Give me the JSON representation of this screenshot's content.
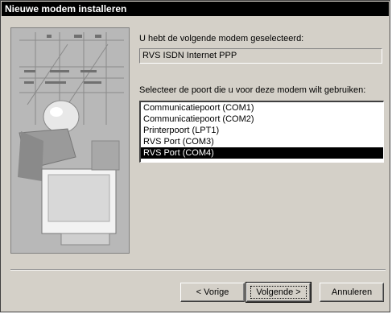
{
  "window": {
    "title": "Nieuwe modem installeren"
  },
  "content": {
    "selected_label": "U hebt de volgende modem geselecteerd:",
    "selected_modem": "RVS ISDN Internet PPP",
    "port_label": "Selecteer de poort die u voor deze modem wilt gebruiken:",
    "ports": [
      {
        "label": "Communicatiepoort (COM1)",
        "selected": false
      },
      {
        "label": "Communicatiepoort (COM2)",
        "selected": false
      },
      {
        "label": "Printerpoort (LPT1)",
        "selected": false
      },
      {
        "label": "RVS Port (COM3)",
        "selected": false
      },
      {
        "label": "RVS Port (COM4)",
        "selected": true
      }
    ]
  },
  "buttons": {
    "back": "< Vorige",
    "next": "Volgende >",
    "cancel": "Annuleren"
  }
}
